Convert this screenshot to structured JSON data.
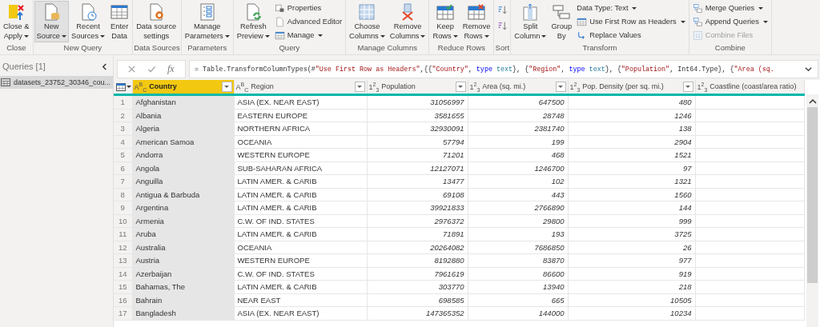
{
  "ribbon": {
    "groups": [
      {
        "label": "Close",
        "items": [
          {
            "kind": "large",
            "label": "Close &\nApply",
            "dropdown": true,
            "highlighted": false,
            "disabled": false
          }
        ]
      },
      {
        "label": "New Query",
        "items": [
          {
            "kind": "large",
            "label": "New\nSource",
            "dropdown": true,
            "highlighted": true,
            "disabled": false
          },
          {
            "kind": "large",
            "label": "Recent\nSources",
            "dropdown": true,
            "highlighted": false,
            "disabled": false
          },
          {
            "kind": "large",
            "label": "Enter\nData",
            "dropdown": false,
            "highlighted": false,
            "disabled": false
          }
        ]
      },
      {
        "label": "Data Sources",
        "items": [
          {
            "kind": "large",
            "label": "Data source\nsettings",
            "dropdown": false,
            "highlighted": false,
            "disabled": false
          }
        ]
      },
      {
        "label": "Parameters",
        "items": [
          {
            "kind": "large",
            "label": "Manage\nParameters",
            "dropdown": true,
            "highlighted": false,
            "disabled": false
          }
        ]
      },
      {
        "label": "Query",
        "items": [
          {
            "kind": "large",
            "label": "Refresh\nPreview",
            "dropdown": true,
            "highlighted": false,
            "disabled": false
          },
          {
            "kind": "small",
            "label": "Properties",
            "dropdown": false,
            "highlighted": false,
            "disabled": false
          },
          {
            "kind": "small",
            "label": "Advanced Editor",
            "dropdown": false,
            "highlighted": false,
            "disabled": false
          },
          {
            "kind": "small",
            "label": "Manage",
            "dropdown": true,
            "highlighted": false,
            "disabled": false
          }
        ]
      },
      {
        "label": "Manage Columns",
        "items": [
          {
            "kind": "large",
            "label": "Choose\nColumns",
            "dropdown": true,
            "highlighted": false,
            "disabled": false
          },
          {
            "kind": "large",
            "label": "Remove\nColumns",
            "dropdown": true,
            "highlighted": false,
            "disabled": false
          }
        ]
      },
      {
        "label": "Reduce Rows",
        "items": [
          {
            "kind": "large",
            "label": "Keep\nRows",
            "dropdown": true,
            "highlighted": false,
            "disabled": false
          },
          {
            "kind": "large",
            "label": "Remove\nRows",
            "dropdown": true,
            "highlighted": false,
            "disabled": false
          }
        ]
      },
      {
        "label": "Sort",
        "items": [
          {
            "kind": "icon",
            "highlighted": false,
            "disabled": false
          },
          {
            "kind": "icon",
            "highlighted": false,
            "disabled": false
          }
        ]
      },
      {
        "label": "Transform",
        "items": [
          {
            "kind": "large",
            "label": "Split\nColumn",
            "dropdown": true,
            "highlighted": false,
            "disabled": false
          },
          {
            "kind": "large",
            "label": "Group\nBy",
            "dropdown": false,
            "highlighted": false,
            "disabled": false
          },
          {
            "kind": "small",
            "label": "Data Type: Text",
            "dropdown": true,
            "highlighted": false,
            "disabled": false
          },
          {
            "kind": "small",
            "label": "Use First Row as Headers",
            "dropdown": true,
            "highlighted": false,
            "disabled": false
          },
          {
            "kind": "small",
            "label": "Replace Values",
            "dropdown": false,
            "highlighted": false,
            "disabled": false
          }
        ]
      },
      {
        "label": "Combine",
        "items": [
          {
            "kind": "small",
            "label": "Merge Queries",
            "dropdown": true,
            "highlighted": false,
            "disabled": false
          },
          {
            "kind": "small",
            "label": "Append Queries",
            "dropdown": true,
            "highlighted": false,
            "disabled": false
          },
          {
            "kind": "small",
            "label": "Combine Files",
            "dropdown": false,
            "highlighted": false,
            "disabled": true
          }
        ]
      }
    ]
  },
  "queries_pane": {
    "title": "Queries [1]",
    "items": [
      {
        "label": "datasets_23752_30346_cou...",
        "selected": true
      }
    ]
  },
  "formula_bar": {
    "fx_label": "fx",
    "tokens": [
      {
        "kind": "plain",
        "text": "= Table.TransformColumnTypes(#"
      },
      {
        "kind": "string",
        "text": "\"Use First Row as Headers\""
      },
      {
        "kind": "plain",
        "text": ",{{"
      },
      {
        "kind": "string",
        "text": "\"Country\""
      },
      {
        "kind": "plain",
        "text": ", "
      },
      {
        "kind": "keyword",
        "text": "type"
      },
      {
        "kind": "typename",
        "text": " text"
      },
      {
        "kind": "plain",
        "text": "}, {"
      },
      {
        "kind": "string",
        "text": "\"Region\""
      },
      {
        "kind": "plain",
        "text": ", "
      },
      {
        "kind": "keyword",
        "text": "type"
      },
      {
        "kind": "typename",
        "text": " text"
      },
      {
        "kind": "plain",
        "text": "}, {"
      },
      {
        "kind": "string",
        "text": "\"Population\""
      },
      {
        "kind": "plain",
        "text": ", Int64.Type}, {"
      },
      {
        "kind": "string",
        "text": "\"Area (sq."
      }
    ]
  },
  "table": {
    "columns": [
      {
        "name": "Country",
        "kind": "text",
        "type_label": "A$^{B}$$_{C}$",
        "selected": true,
        "filter": true
      },
      {
        "name": "Region",
        "kind": "text",
        "type_label": "A$^{B}$$_{C}$",
        "selected": false,
        "filter": true
      },
      {
        "name": "Population",
        "kind": "number",
        "type_label": "1$^{2}$$_{3}$",
        "selected": false,
        "filter": true
      },
      {
        "name": "Area (sq. mi.)",
        "kind": "number",
        "type_label": "1$^{2}$$_{3}$",
        "selected": false,
        "filter": true
      },
      {
        "name": "Pop. Density (per sq. mi.)",
        "kind": "number",
        "type_label": "1$^{2}$$_{3}$",
        "selected": false,
        "filter": true
      },
      {
        "name": "Coastline (coast/area ratio)",
        "kind": "number",
        "type_label": "1$^{2}$$_{3}$",
        "selected": false,
        "filter": false
      }
    ],
    "rows": [
      {
        "number": "1",
        "cells": [
          "Afghanistan",
          "ASIA (EX. NEAR EAST)",
          "31056997",
          "647500",
          "480"
        ]
      },
      {
        "number": "2",
        "cells": [
          "Albania",
          "EASTERN EUROPE",
          "3581655",
          "28748",
          "1246"
        ]
      },
      {
        "number": "3",
        "cells": [
          "Algeria",
          "NORTHERN AFRICA",
          "32930091",
          "2381740",
          "138"
        ]
      },
      {
        "number": "4",
        "cells": [
          "American Samoa",
          "OCEANIA",
          "57794",
          "199",
          "2904"
        ]
      },
      {
        "number": "5",
        "cells": [
          "Andorra",
          "WESTERN EUROPE",
          "71201",
          "468",
          "1521"
        ]
      },
      {
        "number": "6",
        "cells": [
          "Angola",
          "SUB-SAHARAN AFRICA",
          "12127071",
          "1246700",
          "97"
        ]
      },
      {
        "number": "7",
        "cells": [
          "Anguilla",
          "LATIN AMER. & CARIB",
          "13477",
          "102",
          "1321"
        ]
      },
      {
        "number": "8",
        "cells": [
          "Antigua & Barbuda",
          "LATIN AMER. & CARIB",
          "69108",
          "443",
          "1560"
        ]
      },
      {
        "number": "9",
        "cells": [
          "Argentina",
          "LATIN AMER. & CARIB",
          "39921833",
          "2766890",
          "144"
        ]
      },
      {
        "number": "10",
        "cells": [
          "Armenia",
          "C.W. OF IND. STATES",
          "2976372",
          "29800",
          "999"
        ]
      },
      {
        "number": "11",
        "cells": [
          "Aruba",
          "LATIN AMER. & CARIB",
          "71891",
          "193",
          "3725"
        ]
      },
      {
        "number": "12",
        "cells": [
          "Australia",
          "OCEANIA",
          "20264082",
          "7686850",
          "26"
        ]
      },
      {
        "number": "13",
        "cells": [
          "Austria",
          "WESTERN EUROPE",
          "8192880",
          "83870",
          "977"
        ]
      },
      {
        "number": "14",
        "cells": [
          "Azerbaijan",
          "C.W. OF IND. STATES",
          "7961619",
          "86600",
          "919"
        ]
      },
      {
        "number": "15",
        "cells": [
          "Bahamas, The",
          "LATIN AMER. & CARIB",
          "303770",
          "13940",
          "218"
        ]
      },
      {
        "number": "16",
        "cells": [
          "Bahrain",
          "NEAR EAST",
          "698585",
          "665",
          "10505"
        ]
      },
      {
        "number": "17",
        "cells": [
          "Bangladesh",
          "ASIA (EX. NEAR EAST)",
          "147365352",
          "144000",
          "10234"
        ]
      }
    ]
  }
}
